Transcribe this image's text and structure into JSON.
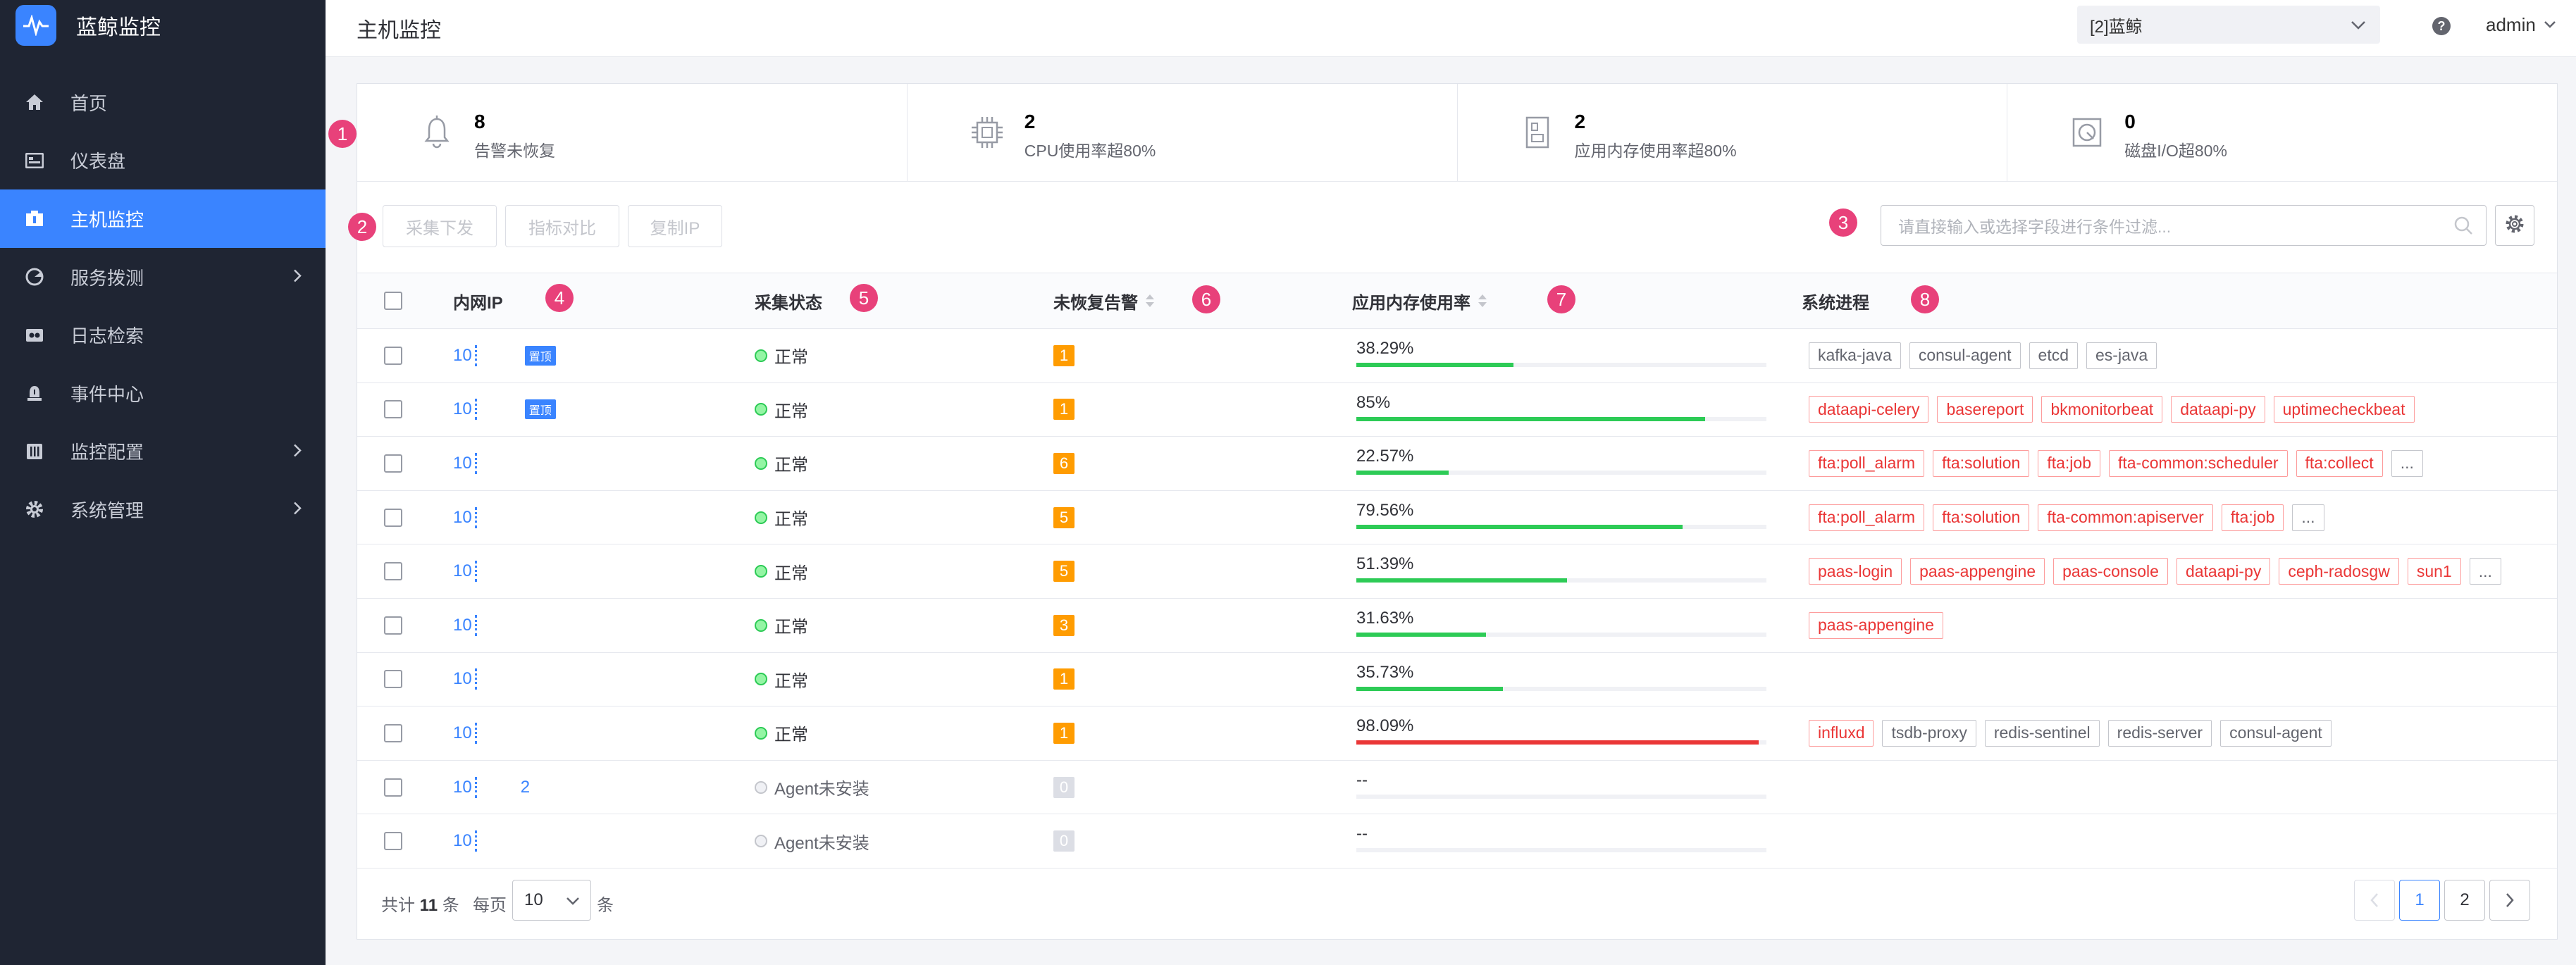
{
  "app": {
    "name": "蓝鲸监控"
  },
  "sidebar": {
    "items": [
      {
        "label": "首页"
      },
      {
        "label": "仪表盘"
      },
      {
        "label": "主机监控"
      },
      {
        "label": "服务拨测"
      },
      {
        "label": "日志检索"
      },
      {
        "label": "事件中心"
      },
      {
        "label": "监控配置"
      },
      {
        "label": "系统管理"
      }
    ]
  },
  "header": {
    "title": "主机监控",
    "business": "[2]蓝鲸",
    "help": "?",
    "user": "admin"
  },
  "stats": [
    {
      "value": "8",
      "label": "告警未恢复"
    },
    {
      "value": "2",
      "label": "CPU使用率超80%"
    },
    {
      "value": "2",
      "label": "应用内存使用率超80%"
    },
    {
      "value": "0",
      "label": "磁盘I/O超80%"
    }
  ],
  "toolbar": {
    "collect_label": "采集下发",
    "compare_label": "指标对比",
    "copy_ip_label": "复制IP",
    "search_placeholder": "请直接输入或选择字段进行条件过滤..."
  },
  "markers": [
    "1",
    "2",
    "3",
    "4",
    "5",
    "6",
    "7",
    "8"
  ],
  "table": {
    "columns": {
      "ip": "内网IP",
      "status": "采集状态",
      "alarms": "未恢复告警",
      "mem": "应用内存使用率",
      "proc": "系统进程"
    },
    "top_label": "置顶",
    "rows": [
      {
        "ip": "10",
        "top": true,
        "status": "正常",
        "alarms": "1",
        "mem": "38.29%",
        "mem_value": 38.29,
        "procs": [
          {
            "n": "kafka-java",
            "err": false
          },
          {
            "n": "consul-agent",
            "err": false
          },
          {
            "n": "etcd",
            "err": false
          },
          {
            "n": "es-java",
            "err": false
          }
        ],
        "more": false
      },
      {
        "ip": "10",
        "top": true,
        "status": "正常",
        "alarms": "1",
        "mem": "85%",
        "mem_value": 85,
        "procs": [
          {
            "n": "dataapi-celery",
            "err": true
          },
          {
            "n": "basereport",
            "err": true
          },
          {
            "n": "bkmonitorbeat",
            "err": true
          },
          {
            "n": "dataapi-py",
            "err": true
          },
          {
            "n": "uptimecheckbeat",
            "err": true
          }
        ],
        "more": false
      },
      {
        "ip": "10",
        "top": false,
        "status": "正常",
        "alarms": "6",
        "mem": "22.57%",
        "mem_value": 22.57,
        "procs": [
          {
            "n": "fta:poll_alarm",
            "err": true
          },
          {
            "n": "fta:solution",
            "err": true
          },
          {
            "n": "fta:job",
            "err": true
          },
          {
            "n": "fta-common:scheduler",
            "err": true
          },
          {
            "n": "fta:collect",
            "err": true
          }
        ],
        "more": true
      },
      {
        "ip": "10",
        "top": false,
        "status": "正常",
        "alarms": "5",
        "mem": "79.56%",
        "mem_value": 79.56,
        "procs": [
          {
            "n": "fta:poll_alarm",
            "err": true
          },
          {
            "n": "fta:solution",
            "err": true
          },
          {
            "n": "fta-common:apiserver",
            "err": true
          },
          {
            "n": "fta:job",
            "err": true
          }
        ],
        "more": true
      },
      {
        "ip": "10",
        "top": false,
        "status": "正常",
        "alarms": "5",
        "mem": "51.39%",
        "mem_value": 51.39,
        "procs": [
          {
            "n": "paas-login",
            "err": true
          },
          {
            "n": "paas-appengine",
            "err": true
          },
          {
            "n": "paas-console",
            "err": true
          },
          {
            "n": "dataapi-py",
            "err": true
          },
          {
            "n": "ceph-radosgw",
            "err": true
          },
          {
            "n": "sun1",
            "err": true
          }
        ],
        "more": true
      },
      {
        "ip": "10",
        "top": false,
        "status": "正常",
        "alarms": "3",
        "mem": "31.63%",
        "mem_value": 31.63,
        "procs": [
          {
            "n": "paas-appengine",
            "err": true
          }
        ],
        "more": false
      },
      {
        "ip": "10",
        "top": false,
        "status": "正常",
        "alarms": "1",
        "mem": "35.73%",
        "mem_value": 35.73,
        "procs": [],
        "more": false
      },
      {
        "ip": "10",
        "top": false,
        "status": "正常",
        "alarms": "1",
        "mem": "98.09%",
        "mem_value": 98.09,
        "procs": [
          {
            "n": "influxd",
            "err": true
          },
          {
            "n": "tsdb-proxy",
            "err": false
          },
          {
            "n": "redis-sentinel",
            "err": false
          },
          {
            "n": "redis-server",
            "err": false
          },
          {
            "n": "consul-agent",
            "err": false
          }
        ],
        "more": false
      },
      {
        "ip": "10",
        "ip_suffix": "2",
        "top": false,
        "status": "Agent未安装",
        "alarms": "0",
        "mem": "--",
        "mem_value": null,
        "procs": [],
        "more": false
      },
      {
        "ip": "10",
        "top": false,
        "status": "Agent未安装",
        "alarms": "0",
        "mem": "--",
        "mem_value": null,
        "procs": [],
        "more": false
      }
    ],
    "more_label": "..."
  },
  "footer": {
    "total_prefix": "共计",
    "total": "11",
    "total_suffix": "条",
    "per_page_prefix": "每页",
    "per_page": "10",
    "per_page_suffix": "条",
    "pages": [
      "1",
      "2"
    ],
    "current_page": "1"
  },
  "colors": {
    "accent": "#3a84ff",
    "sidebar_bg": "#1f2533",
    "ok": "#2dcb56",
    "warn": "#ff9c01",
    "error": "#ea3636",
    "marker": "#e8417a"
  }
}
